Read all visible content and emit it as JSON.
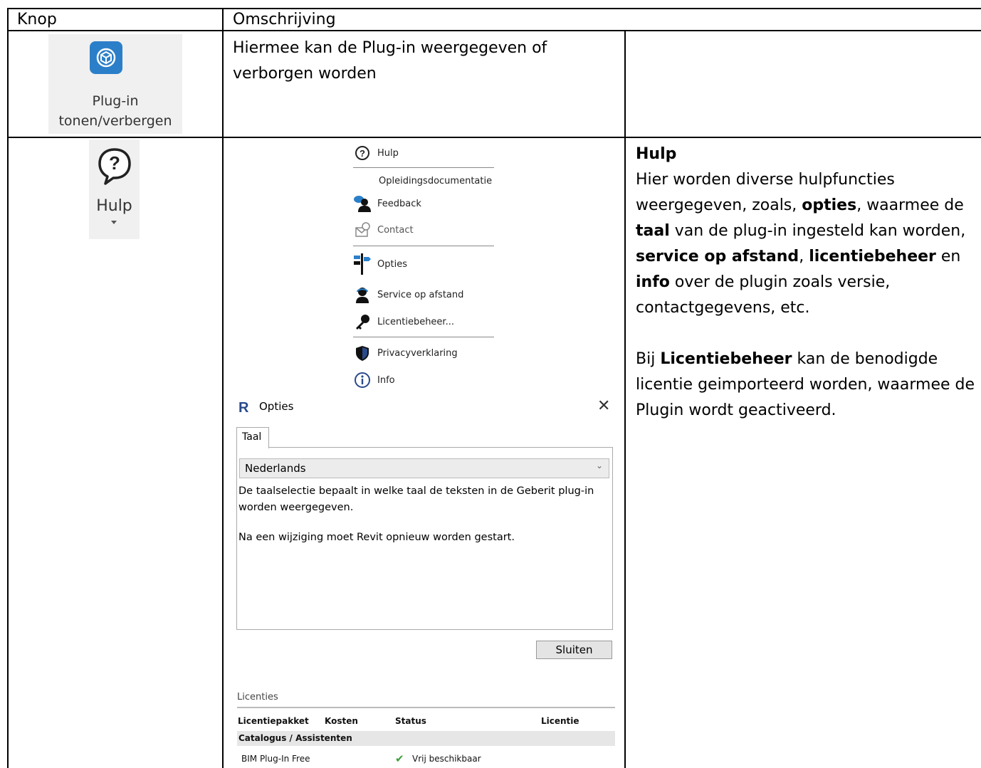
{
  "table": {
    "headers": [
      "Knop",
      "Omschrijving"
    ],
    "row1": {
      "button_label_1": "Plug-in",
      "button_label_2": "tonen/verbergen",
      "description": "Hiermee kan de Plug-in weergegeven of verborgen worden"
    },
    "row2": {
      "button_label": "Hulp",
      "right_title": "Hulp",
      "right_p1": [
        {
          "t": "Hier worden diverse hulpfuncties weergegeven, zoals, ",
          "b": false
        },
        {
          "t": "opties",
          "b": true
        },
        {
          "t": ", waarmee de ",
          "b": false
        },
        {
          "t": "taal",
          "b": true
        },
        {
          "t": " van de plug-in ingesteld kan worden, ",
          "b": false
        },
        {
          "t": "service op afstand",
          "b": true
        },
        {
          "t": ", ",
          "b": false
        },
        {
          "t": "licentiebeheer",
          "b": true
        },
        {
          "t": " en ",
          "b": false
        },
        {
          "t": "info",
          "b": true
        },
        {
          "t": " over de plugin zoals versie, contactgegevens, etc.",
          "b": false
        }
      ],
      "right_p2": [
        {
          "t": "Bij ",
          "b": false
        },
        {
          "t": "Licentiebeheer",
          "b": true
        },
        {
          "t": " kan de benodigde licentie geimporteerd worden, waarmee de Plugin wordt geactiveerd.",
          "b": false
        }
      ]
    }
  },
  "menu": {
    "hulp": "Hulp",
    "opleidings": "Opleidingsdocumentatie",
    "feedback": "Feedback",
    "contact": "Contact",
    "opties": "Opties",
    "service": "Service op afstand",
    "licentie": "Licentiebeheer...",
    "privacy": "Privacyverklaring",
    "info": "Info"
  },
  "dialog": {
    "title": "Opties",
    "tab": "Taal",
    "language_value": "Nederlands",
    "desc1": "De taalselectie bepaalt in welke taal de teksten in de Geberit plug-in",
    "desc2": "worden weergegeven.",
    "desc3": "Na een wijziging moet Revit opnieuw worden gestart.",
    "close_button": "Sluiten"
  },
  "licenses": {
    "section": "Licenties",
    "columns": [
      "Licentiepakket",
      "Kosten",
      "Status",
      "Licentie"
    ],
    "group": "Catalogus / Assistenten",
    "rows": [
      {
        "package": "BIM Plug-In Free",
        "status": "Vrij beschikbaar"
      }
    ]
  },
  "colors": {
    "plugin_icon": "#2b7fc9",
    "check_green": "#3aa03a",
    "shield_blue": "#2a4a8a"
  }
}
